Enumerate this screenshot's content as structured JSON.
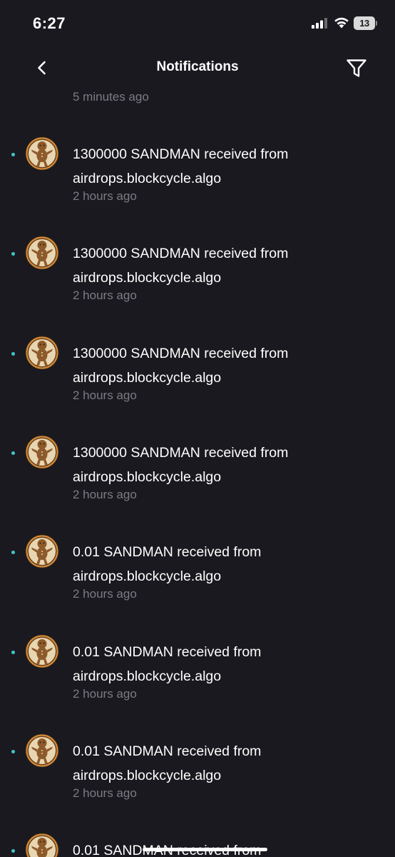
{
  "status_bar": {
    "time": "6:27",
    "battery": "13"
  },
  "header": {
    "title": "Notifications"
  },
  "list": {
    "partial_timestamp": "5 minutes ago",
    "items": [
      {
        "line1": "1300000 SANDMAN received from",
        "line2": "airdrops.blockcycle.algo",
        "time": "2 hours ago"
      },
      {
        "line1": "1300000 SANDMAN received from",
        "line2": "airdrops.blockcycle.algo",
        "time": "2 hours ago"
      },
      {
        "line1": "1300000 SANDMAN received from",
        "line2": "airdrops.blockcycle.algo",
        "time": "2 hours ago"
      },
      {
        "line1": "1300000 SANDMAN received from",
        "line2": "airdrops.blockcycle.algo",
        "time": "2 hours ago"
      },
      {
        "line1": "0.01 SANDMAN received from",
        "line2": "airdrops.blockcycle.algo",
        "time": "2 hours ago"
      },
      {
        "line1": "0.01 SANDMAN received from",
        "line2": "airdrops.blockcycle.algo",
        "time": "2 hours ago"
      },
      {
        "line1": "0.01 SANDMAN received from",
        "line2": "airdrops.blockcycle.algo",
        "time": "2 hours ago"
      },
      {
        "line1": "0.01 SANDMAN received from",
        "line2": "",
        "time": ""
      }
    ]
  },
  "colors": {
    "background": "#1a191f",
    "unread_dot": "#3fc7c7",
    "muted_text": "#7c7b83"
  },
  "icons": {
    "back": "chevron-left-icon",
    "filter": "filter-funnel-icon",
    "avatar": "sandman-token-icon"
  }
}
